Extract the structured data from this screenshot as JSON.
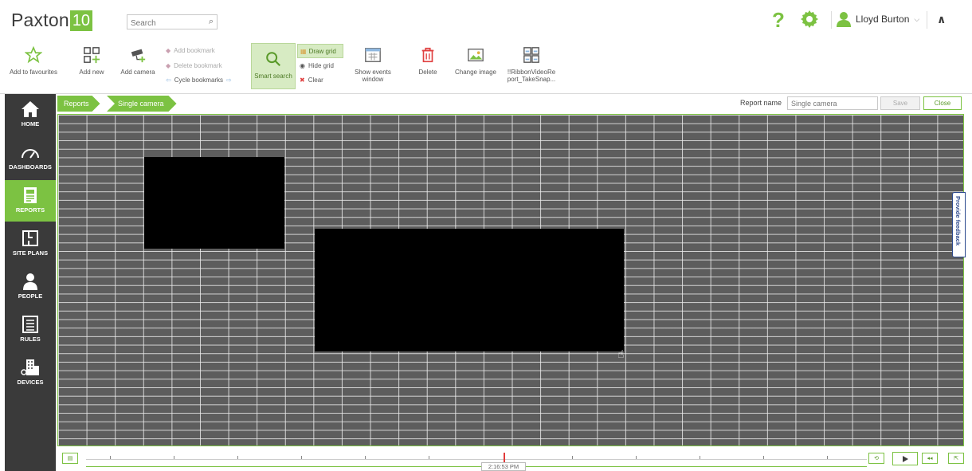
{
  "app": {
    "logo_word": "Paxton",
    "logo_number": "10",
    "brand_color": "#7cc242"
  },
  "header": {
    "search_placeholder": "Search",
    "help_icon": "question-mark-icon",
    "settings_icon": "gear-icon",
    "user_name": "Lloyd Burton"
  },
  "ribbon": {
    "add_to_favourites": "Add to favourites",
    "add_new": "Add new",
    "add_camera": "Add camera",
    "add_bookmark": "Add bookmark",
    "delete_bookmark": "Delete bookmark",
    "cycle_bookmarks": "Cycle bookmarks",
    "smart_search": "Smart search",
    "draw_grid": "Draw grid",
    "hide_grid": "Hide grid",
    "clear": "Clear",
    "show_events_window_line1": "Show events",
    "show_events_window_line2": "window",
    "delete": "Delete",
    "change_image": "Change image",
    "take_snapshot_line1": "!!RibbonVideoRe",
    "take_snapshot_line2": "port_TakeSnap..."
  },
  "sidebar": {
    "items": [
      {
        "label": "HOME",
        "icon": "home-icon"
      },
      {
        "label": "DASHBOARDS",
        "icon": "gauge-icon"
      },
      {
        "label": "REPORTS",
        "icon": "report-icon",
        "active": true
      },
      {
        "label": "SITE PLANS",
        "icon": "floor-plan-icon"
      },
      {
        "label": "PEOPLE",
        "icon": "person-icon"
      },
      {
        "label": "RULES",
        "icon": "list-icon"
      },
      {
        "label": "DEVICES",
        "icon": "building-icon"
      }
    ]
  },
  "breadcrumb": {
    "items": [
      "Reports",
      "Single camera"
    ]
  },
  "report": {
    "name_label": "Report name",
    "name_value": "Single camera",
    "save_label": "Save",
    "close_label": "Close"
  },
  "feedback_tab": "Provide feedback",
  "timeline": {
    "current_time": "2:16:53 PM"
  }
}
